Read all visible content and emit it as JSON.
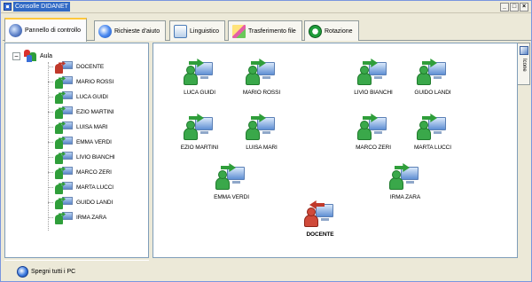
{
  "window": {
    "title": "Consolle DIDANET",
    "controls": {
      "minimize": "_",
      "maximize": "□",
      "close": "×"
    }
  },
  "tabs": [
    {
      "label": "Pannello di controllo",
      "icon": "control-panel-icon",
      "active": true
    },
    {
      "label": "Richieste d'aiuto",
      "icon": "help-request-icon",
      "active": false
    },
    {
      "label": "Linguistico",
      "icon": "language-icon",
      "active": false
    },
    {
      "label": "Trasferimento file",
      "icon": "file-transfer-icon",
      "active": false
    },
    {
      "label": "Rotazione",
      "icon": "rotation-icon",
      "active": false
    }
  ],
  "tree": {
    "expander": "−",
    "root_label": "Aula",
    "items": [
      {
        "label": "DOCENTE",
        "type": "teacher"
      },
      {
        "label": "MARIO ROSSI",
        "type": "student"
      },
      {
        "label": "LUCA GUIDI",
        "type": "student"
      },
      {
        "label": "EZIO MARTINI",
        "type": "student"
      },
      {
        "label": "LUISA MARI",
        "type": "student"
      },
      {
        "label": "EMMA VERDI",
        "type": "student"
      },
      {
        "label": "LIVIO BIANCHI",
        "type": "student"
      },
      {
        "label": "MARCO ZERI",
        "type": "student"
      },
      {
        "label": "MARTA LUCCI",
        "type": "student"
      },
      {
        "label": "GUIDO LANDI",
        "type": "student"
      },
      {
        "label": "IRMA ZARA",
        "type": "student"
      }
    ]
  },
  "bottom": {
    "shutdown_label": "Spegni tutti i PC"
  },
  "side_tab": {
    "label": "Icone"
  },
  "computers": [
    {
      "label": "LUCA GUIDI",
      "type": "student"
    },
    {
      "label": "MARIO ROSSI",
      "type": "student"
    },
    {
      "label": "LIVIO BIANCHI",
      "type": "student"
    },
    {
      "label": "GUIDO LANDI",
      "type": "student"
    },
    {
      "label": "EZIO MARTINI",
      "type": "student"
    },
    {
      "label": "LUISA MARI",
      "type": "student"
    },
    {
      "label": "MARCO ZERI",
      "type": "student"
    },
    {
      "label": "MARTA LUCCI",
      "type": "student"
    },
    {
      "label": "EMMA VERDI",
      "type": "student"
    },
    {
      "label": "IRMA ZARA",
      "type": "student"
    },
    {
      "label": "DOCENTE",
      "type": "teacher"
    }
  ]
}
